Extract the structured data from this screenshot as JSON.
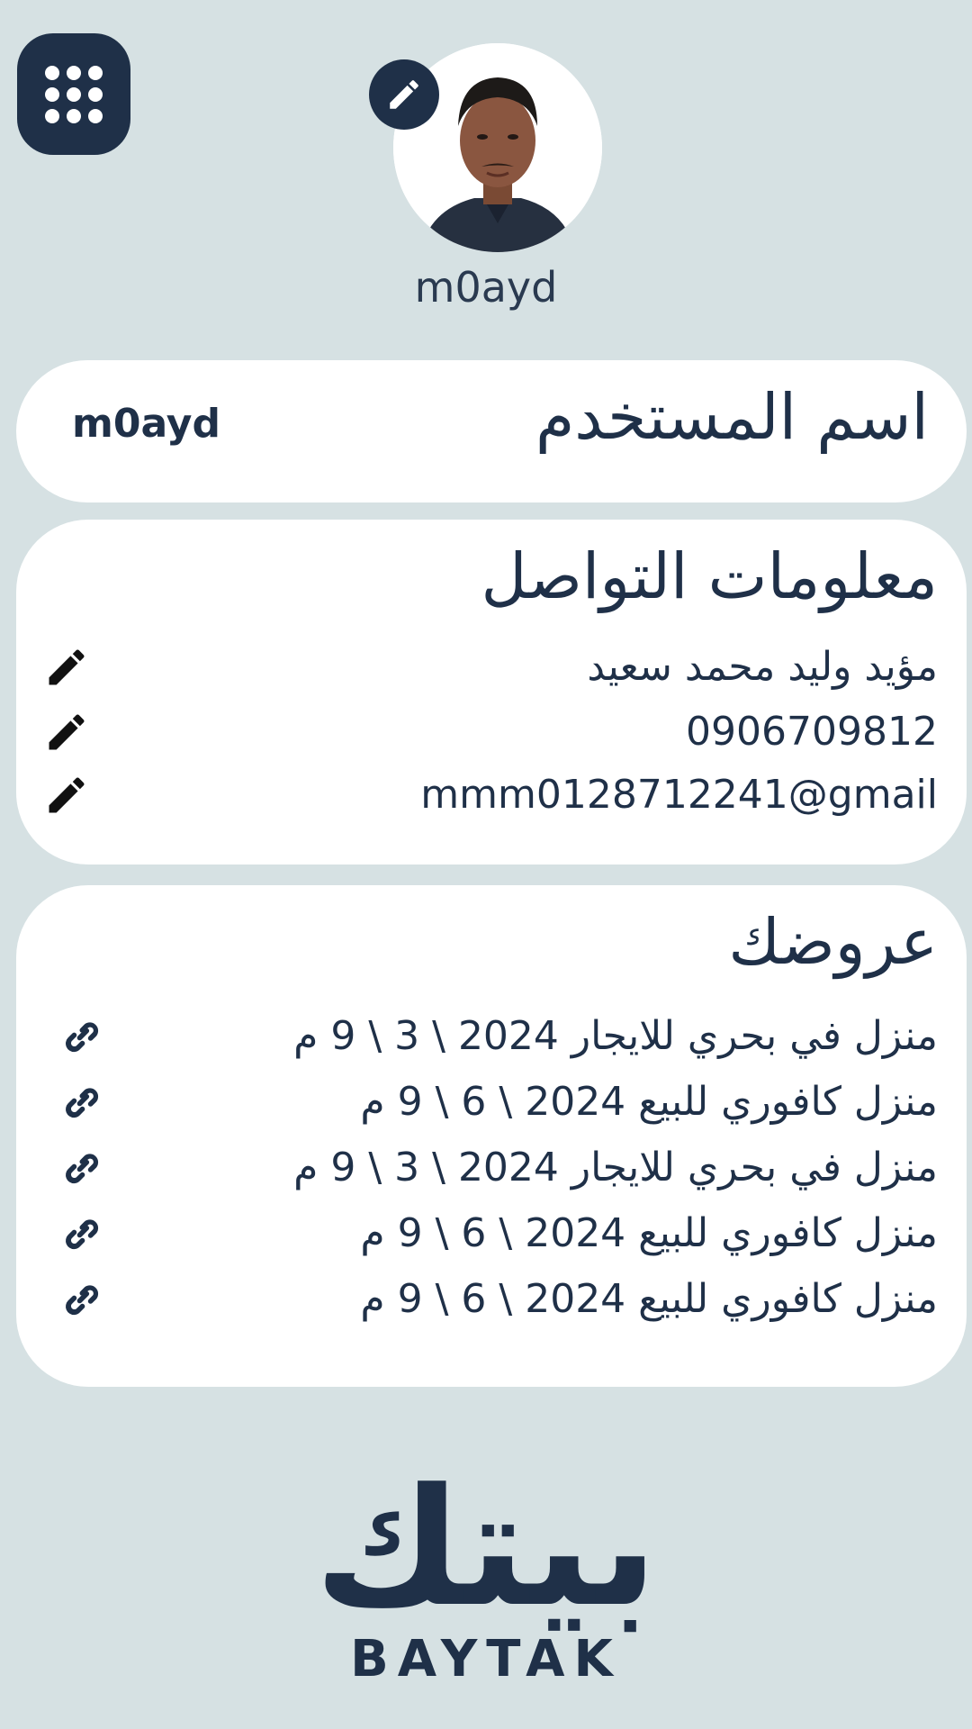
{
  "profile": {
    "display_name": "m0ayd"
  },
  "username_card": {
    "label": "اسم المستخدم",
    "value": "m0ayd"
  },
  "contact": {
    "title": "معلومات التواصل",
    "full_name": "مؤيد وليد محمد سعيد",
    "phone": "0906709812",
    "email": "mmm0128712241@gmail"
  },
  "offers": {
    "title": "عروضك",
    "items": [
      "منزل في بحري للايجار 2024 \\ 3 \\ 9 م",
      "منزل كافوري للبيع 2024 \\ 6 \\ 9 م",
      "منزل في بحري للايجار 2024 \\ 3 \\ 9 م",
      "منزل كافوري للبيع 2024 \\ 6 \\ 9 م",
      "منزل كافوري للبيع 2024 \\ 6 \\ 9 م"
    ]
  },
  "logo": {
    "arabic": "بيتك",
    "english": "BAYTAK"
  },
  "icons": {
    "menu": "grid-dots-icon",
    "avatar_edit": "pencil-icon",
    "field_edit": "pencil-icon",
    "offer_link": "link-icon"
  },
  "colors": {
    "background": "#d6e1e3",
    "primary": "#1f3048",
    "card": "#ffffff"
  }
}
